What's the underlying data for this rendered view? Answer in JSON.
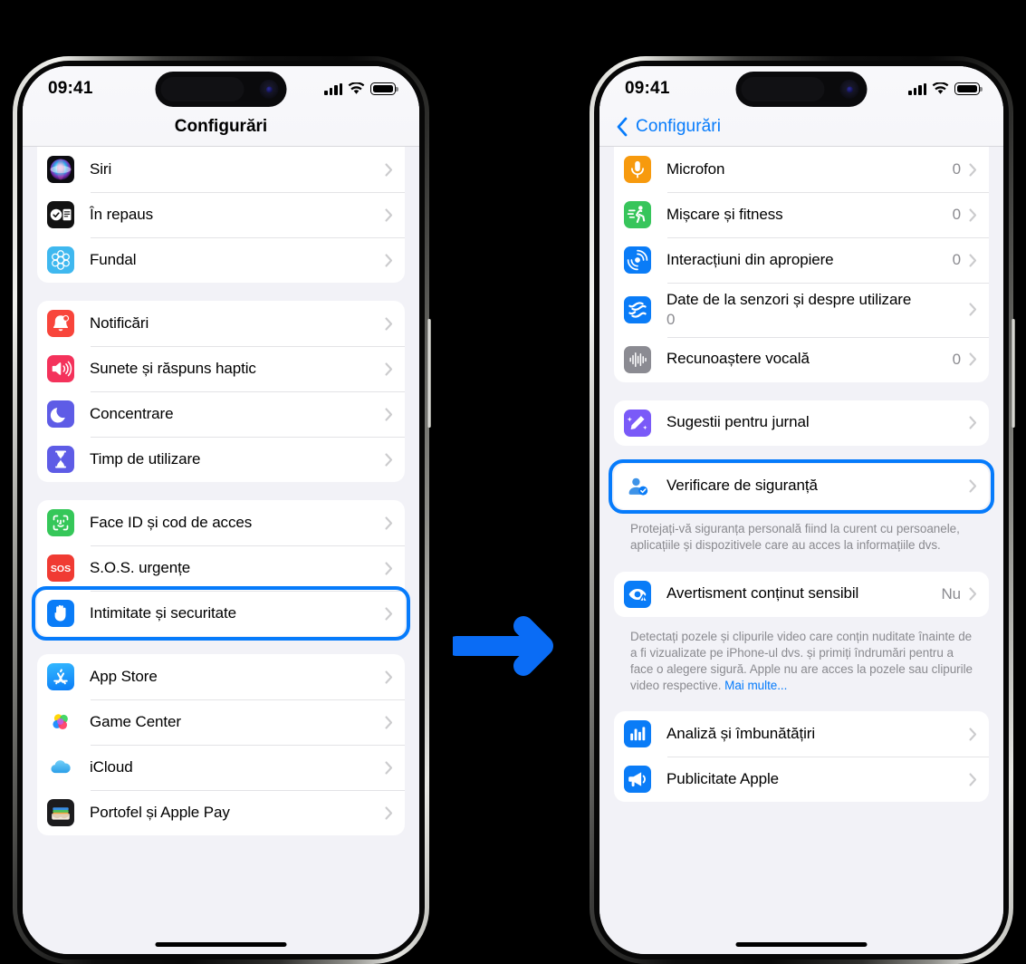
{
  "meta": {
    "accent_blue": "#067bfb",
    "arrow_color": "#0a6cf5",
    "screen_bg": "#f2f2f7"
  },
  "arrow": {
    "name": "right-arrow",
    "direction": "right"
  },
  "left_phone": {
    "status_bar": {
      "time": "09:41",
      "cellular": "signal-bars-icon",
      "wifi": "wifi-icon",
      "battery": "battery-full-icon"
    },
    "nav": {
      "title": "Configurări",
      "has_back": false
    },
    "groups": [
      {
        "clipped_top": true,
        "rows": [
          {
            "label": "Siri",
            "icon": "siri-icon",
            "value": "",
            "chevron": true
          },
          {
            "label": "În repaus",
            "icon": "standby-icon",
            "value": "",
            "chevron": true
          },
          {
            "label": "Fundal",
            "icon": "wallpaper-icon",
            "value": "",
            "chevron": true
          }
        ]
      },
      {
        "clipped_top": false,
        "rows": [
          {
            "label": "Notificări",
            "icon": "notifications-icon",
            "value": "",
            "chevron": true
          },
          {
            "label": "Sunete și răspuns haptic",
            "icon": "sounds-haptics-icon",
            "value": "",
            "chevron": true
          },
          {
            "label": "Concentrare",
            "icon": "focus-icon",
            "value": "",
            "chevron": true
          },
          {
            "label": "Timp de utilizare",
            "icon": "screen-time-icon",
            "value": "",
            "chevron": true
          }
        ]
      },
      {
        "clipped_top": false,
        "rows": [
          {
            "label": "Face ID și cod de acces",
            "icon": "face-id-icon",
            "value": "",
            "chevron": true
          },
          {
            "label": "S.O.S. urgențe",
            "icon": "sos-icon",
            "value": "",
            "chevron": true
          },
          {
            "label": "Intimitate și securitate",
            "icon": "privacy-hand-icon",
            "value": "",
            "chevron": true,
            "highlighted": true
          }
        ]
      },
      {
        "clipped_top": false,
        "rows": [
          {
            "label": "App Store",
            "icon": "app-store-icon",
            "value": "",
            "chevron": true
          },
          {
            "label": "Game Center",
            "icon": "game-center-icon",
            "value": "",
            "chevron": true
          },
          {
            "label": "iCloud",
            "icon": "icloud-icon",
            "value": "",
            "chevron": true
          },
          {
            "label": "Portofel și Apple Pay",
            "icon": "wallet-icon",
            "value": "",
            "chevron": true
          }
        ]
      }
    ]
  },
  "right_phone": {
    "status_bar": {
      "time": "09:41",
      "cellular": "signal-bars-icon",
      "wifi": "wifi-icon",
      "battery": "battery-full-icon"
    },
    "nav": {
      "title": "Configurări",
      "has_back": true,
      "back_label": "Configurări"
    },
    "groups": [
      {
        "clipped_top": true,
        "rows": [
          {
            "label": "Microfon",
            "icon": "microphone-icon",
            "value": "0",
            "chevron": true
          },
          {
            "label": "Mișcare și fitness",
            "icon": "motion-fitness-icon",
            "value": "0",
            "chevron": true
          },
          {
            "label": "Interacțiuni din apropiere",
            "icon": "nearby-interactions-icon",
            "value": "0",
            "chevron": true
          },
          {
            "label": "Date de la senzori și despre utilizare",
            "icon": "sensor-usage-icon",
            "value": "0",
            "chevron": true,
            "multiline": true
          },
          {
            "label": "Recunoaștere vocală",
            "icon": "voice-recognition-icon",
            "value": "0",
            "chevron": true
          }
        ]
      },
      {
        "clipped_top": false,
        "rows": [
          {
            "label": "Sugestii pentru jurnal",
            "icon": "journaling-suggestions-icon",
            "value": "",
            "chevron": true
          }
        ]
      },
      {
        "clipped_top": false,
        "rows": [
          {
            "label": "Verificare de siguranță",
            "icon": "safety-check-icon",
            "value": "",
            "chevron": true,
            "highlighted": true
          }
        ],
        "footnote": "Protejați-vă siguranța personală fiind la curent cu persoanele, aplicațiile și dispozitivele care au acces la informațiile dvs."
      },
      {
        "clipped_top": false,
        "rows": [
          {
            "label": "Avertisment conținut sensibil",
            "icon": "sensitive-content-icon",
            "value": "Nu",
            "chevron": true
          }
        ],
        "footnote": "Detectați pozele și clipurile video care conțin nuditate înainte de a fi vizualizate pe iPhone-ul dvs. și primiți îndrumări pentru a face o alegere sigură. Apple nu are acces la pozele sau clipurile video respective. ",
        "footnote_link": "Mai multe..."
      },
      {
        "clipped_top": false,
        "rows": [
          {
            "label": "Analiză și îmbunătățiri",
            "icon": "analytics-icon",
            "value": "",
            "chevron": true
          },
          {
            "label": "Publicitate Apple",
            "icon": "apple-advertising-icon",
            "value": "",
            "chevron": true
          }
        ]
      }
    ]
  }
}
